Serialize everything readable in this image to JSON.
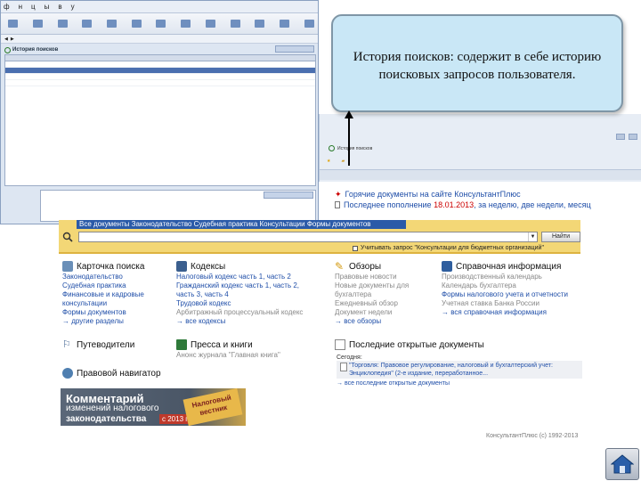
{
  "inset": {
    "menubar": [
      "ф",
      "н",
      "ц",
      "ы",
      "в",
      "у"
    ],
    "toolbar": [
      "",
      "",
      "",
      "",
      "",
      "",
      "",
      "",
      "",
      "",
      "",
      "",
      ""
    ],
    "sub_text": "",
    "panel_title": "История поисков",
    "panel_button": "",
    "grid_rows": [
      {
        "c1": "",
        "c2": "",
        "c3": "",
        "selected": false
      },
      {
        "c1": "",
        "c2": "",
        "c3": "",
        "selected": true
      },
      {
        "c1": "",
        "c2": "",
        "c3": "",
        "selected": false
      },
      {
        "c1": "",
        "c2": "",
        "c3": "",
        "selected": false
      }
    ],
    "bottom_left": "",
    "bottom_box": "",
    "bottom_button": ""
  },
  "callout": {
    "text": "История поисков: содержит в себе историю поисковых запросов пользователя."
  },
  "right_strip": {
    "row1": "История поисков",
    "row2_a": "",
    "row2_b": "",
    "bar_label": ""
  },
  "hot_docs": {
    "line1": "Горячие документы на сайте КонсультантПлюс",
    "line2_prefix": "Последнее пополнение ",
    "line2_date": "18.01.2013",
    "line2_suffix": ", за неделю, две недели, месяц"
  },
  "search": {
    "tabs": "Все документы  Законодательство  Судебная практика  Консультации  Формы документов",
    "placeholder": "",
    "go_button": "Найти",
    "checkbox_label": "Учитывать запрос \"Консультации для бюджетных организаций\""
  },
  "col_card": {
    "title": "Карточка поиска",
    "links": [
      "Законодательство",
      "Судебная практика",
      "Финансовые и кадровые консультации",
      "Формы документов"
    ],
    "more": "другие разделы"
  },
  "col_codes": {
    "title": "Кодексы",
    "links": [
      "Налоговый кодекс часть 1, часть 2",
      "Гражданский кодекс часть 1, часть 2, часть 3, часть 4",
      "Трудовой кодекс",
      "Арбитражный процессуальный кодекс"
    ],
    "more": "все кодексы"
  },
  "col_reviews": {
    "title": "Обзоры",
    "links": [
      "Правовые новости",
      "Новые документы для бухгалтера",
      "Ежедневный обзор",
      "Документ недели"
    ],
    "more": "все обзоры"
  },
  "col_info": {
    "title": "Справочная информация",
    "links": [
      "Производственный календарь",
      "Календарь бухгалтера",
      "Формы налогового учета и отчетности",
      "Учетная ставка Банка России"
    ],
    "more": "вся справочная информация"
  },
  "col_guides": {
    "title": "Путеводители"
  },
  "col_press": {
    "title": "Пресса и книги",
    "link": "Анонс журнала \"Главная книга\""
  },
  "col_navigator": {
    "title": "Правовой навигатор"
  },
  "recent": {
    "title": "Последние открытые документы",
    "today": "Сегодня:",
    "item": "\"Торговля: Правовое регулирование, налоговый и бухгалтерский учет: Энциклопедия\" (2-е издание, переработанное...",
    "more": "все последние открытые документы"
  },
  "banner": {
    "line1": "Комментарий",
    "line2": "изменений налогового",
    "line3": "законодательства",
    "year": "с 2013 г.",
    "badge": "Налоговый вестник"
  },
  "footer": "КонсультантПлюс (с) 1992-2013"
}
